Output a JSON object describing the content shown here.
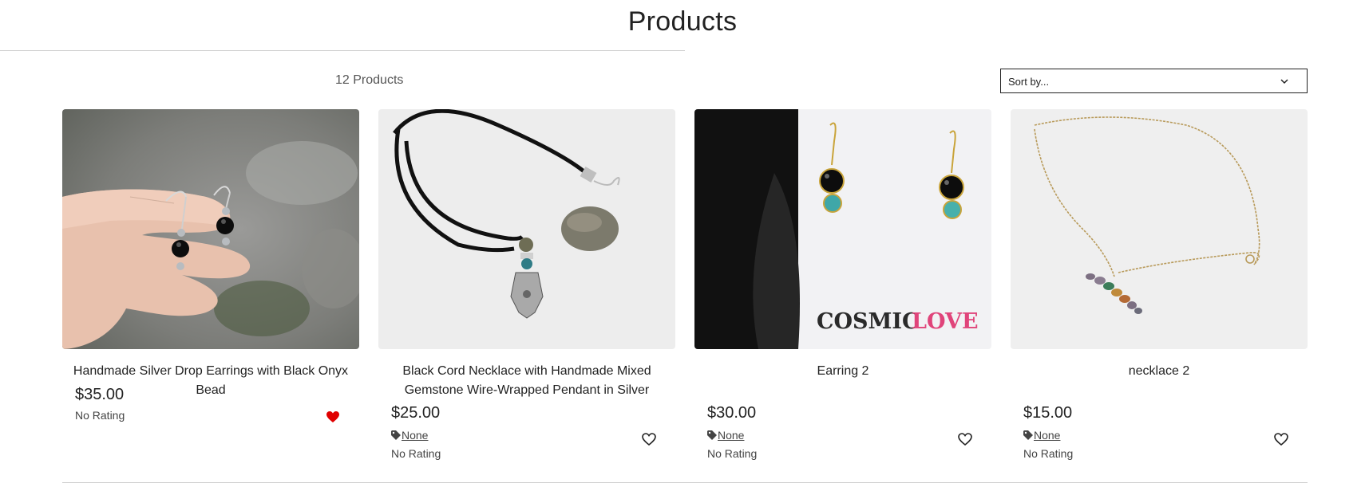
{
  "header": {
    "title": "Products"
  },
  "toolbar": {
    "product_count": "12 Products",
    "sort_placeholder": "Sort by..."
  },
  "products": [
    {
      "title": "Handmade Silver Drop Earrings with Black Onyx Bead",
      "price": "$35.00",
      "category": "",
      "rating": "No Rating",
      "favorited": true,
      "image": "silver-drop-earrings-black-onyx"
    },
    {
      "title": "Black Cord Necklace with Handmade Mixed Gemstone Wire-Wrapped Pendant in Silver",
      "price": "$25.00",
      "category": "None",
      "rating": "No Rating",
      "favorited": false,
      "image": "black-cord-necklace-hamsa-pendant"
    },
    {
      "title": "Earring 2",
      "price": "$30.00",
      "category": "None",
      "rating": "No Rating",
      "favorited": false,
      "image": "gold-wire-earrings-turquoise",
      "image_text": {
        "a": "COSMIC",
        "b": "LOVE"
      }
    },
    {
      "title": "necklace 2",
      "price": "$15.00",
      "category": "None",
      "rating": "No Rating",
      "favorited": false,
      "image": "gold-chain-gemstone-necklace"
    }
  ],
  "colors": {
    "heart_active": "#e00000",
    "text": "#222222",
    "muted": "#555555",
    "rule": "#cfcfcf",
    "cosmic_dark": "#2a2a2a",
    "love_pink": "#e0447a"
  },
  "icons": {
    "sort": "chevron-down-icon",
    "tag": "tag-icon",
    "favorite": "heart-icon"
  }
}
